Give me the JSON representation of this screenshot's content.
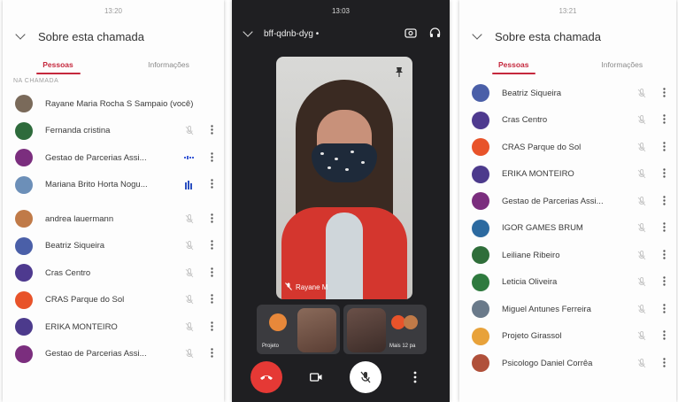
{
  "left_panel": {
    "status": {
      "left": "",
      "time": "13:20",
      "right": ""
    },
    "title": "Sobre esta chamada",
    "tabs": [
      "Pessoas",
      "Informações"
    ],
    "section": "NA CHAMADA",
    "participants": [
      {
        "name": "Rayane Maria Rocha S Sampaio (você)",
        "color": "#7a6a5a",
        "icon": "photo-avatar",
        "mic": "none"
      },
      {
        "name": "Fernanda cristina",
        "color": "#2e6b3c",
        "icon": "letter-avatar",
        "mic": "muted"
      },
      {
        "name": "Gestao de Parcerias Assi...",
        "color": "#7b2e7e",
        "icon": "letter-avatar",
        "mic": "speaking"
      },
      {
        "name": "Mariana Brito Horta Nogu...",
        "color": "#6c8fb8",
        "icon": "photo-avatar",
        "mic": "active"
      },
      {
        "name": "andrea lauermann",
        "color": "#c07a48",
        "icon": "photo-avatar",
        "mic": "muted"
      },
      {
        "name": "Beatriz Siqueira",
        "color": "#4a5fa8",
        "icon": "letter-avatar",
        "mic": "muted"
      },
      {
        "name": "Cras Centro",
        "color": "#4e3a8f",
        "icon": "letter-avatar",
        "mic": "muted"
      },
      {
        "name": "CRAS Parque do Sol",
        "color": "#e8532a",
        "icon": "letter-avatar",
        "mic": "muted"
      },
      {
        "name": "ERIKA MONTEIRO",
        "color": "#4c3a8c",
        "icon": "letter-avatar",
        "mic": "muted"
      },
      {
        "name": "Gestao de Parcerias Assi...",
        "color": "#7b2e7e",
        "icon": "letter-avatar",
        "mic": "muted"
      }
    ]
  },
  "center_panel": {
    "status": {
      "left": "",
      "time": "13:03",
      "right": ""
    },
    "meeting_code": "bff-qdnb-dyg •",
    "main_tile_label": "Rayane M",
    "thumbnails": [
      {
        "label": "Projeto",
        "color": "#4a4a50"
      },
      {
        "label": "",
        "color": "#7a5a4a"
      },
      {
        "label": "Mais 12 pa",
        "color": "#5a4a44"
      }
    ],
    "colors": {
      "end_call": "#e53935",
      "accent": "#c5283d"
    }
  },
  "right_panel": {
    "status": {
      "left": "",
      "time": "13:21",
      "right": ""
    },
    "title": "Sobre esta chamada",
    "tabs": [
      "Pessoas",
      "Informações"
    ],
    "participants": [
      {
        "name": "Beatriz Siqueira",
        "color": "#4a5fa8",
        "icon": "letter-avatar"
      },
      {
        "name": "Cras Centro",
        "color": "#4e3a8f",
        "icon": "letter-avatar"
      },
      {
        "name": "CRAS Parque do Sol",
        "color": "#e8532a",
        "icon": "letter-avatar"
      },
      {
        "name": "ERIKA MONTEIRO",
        "color": "#4c3a8c",
        "icon": "letter-avatar"
      },
      {
        "name": "Gestao de Parcerias Assi...",
        "color": "#7b2e7e",
        "icon": "letter-avatar"
      },
      {
        "name": "IGOR GAMES BRUM",
        "color": "#2c6aa0",
        "icon": "logo-avatar"
      },
      {
        "name": "Leiliane Ribeiro",
        "color": "#2f6e3a",
        "icon": "letter-avatar"
      },
      {
        "name": "Leticia Oliveira",
        "color": "#2e7a3e",
        "icon": "letter-avatar"
      },
      {
        "name": "Miguel Antunes Ferreira",
        "color": "#6a7a8a",
        "icon": "photo-avatar"
      },
      {
        "name": "Projeto Girassol",
        "color": "#e8a23a",
        "icon": "logo-avatar"
      },
      {
        "name": "Psicologo Daniel Corrêa",
        "color": "#b0503a",
        "icon": "photo-avatar"
      }
    ]
  }
}
